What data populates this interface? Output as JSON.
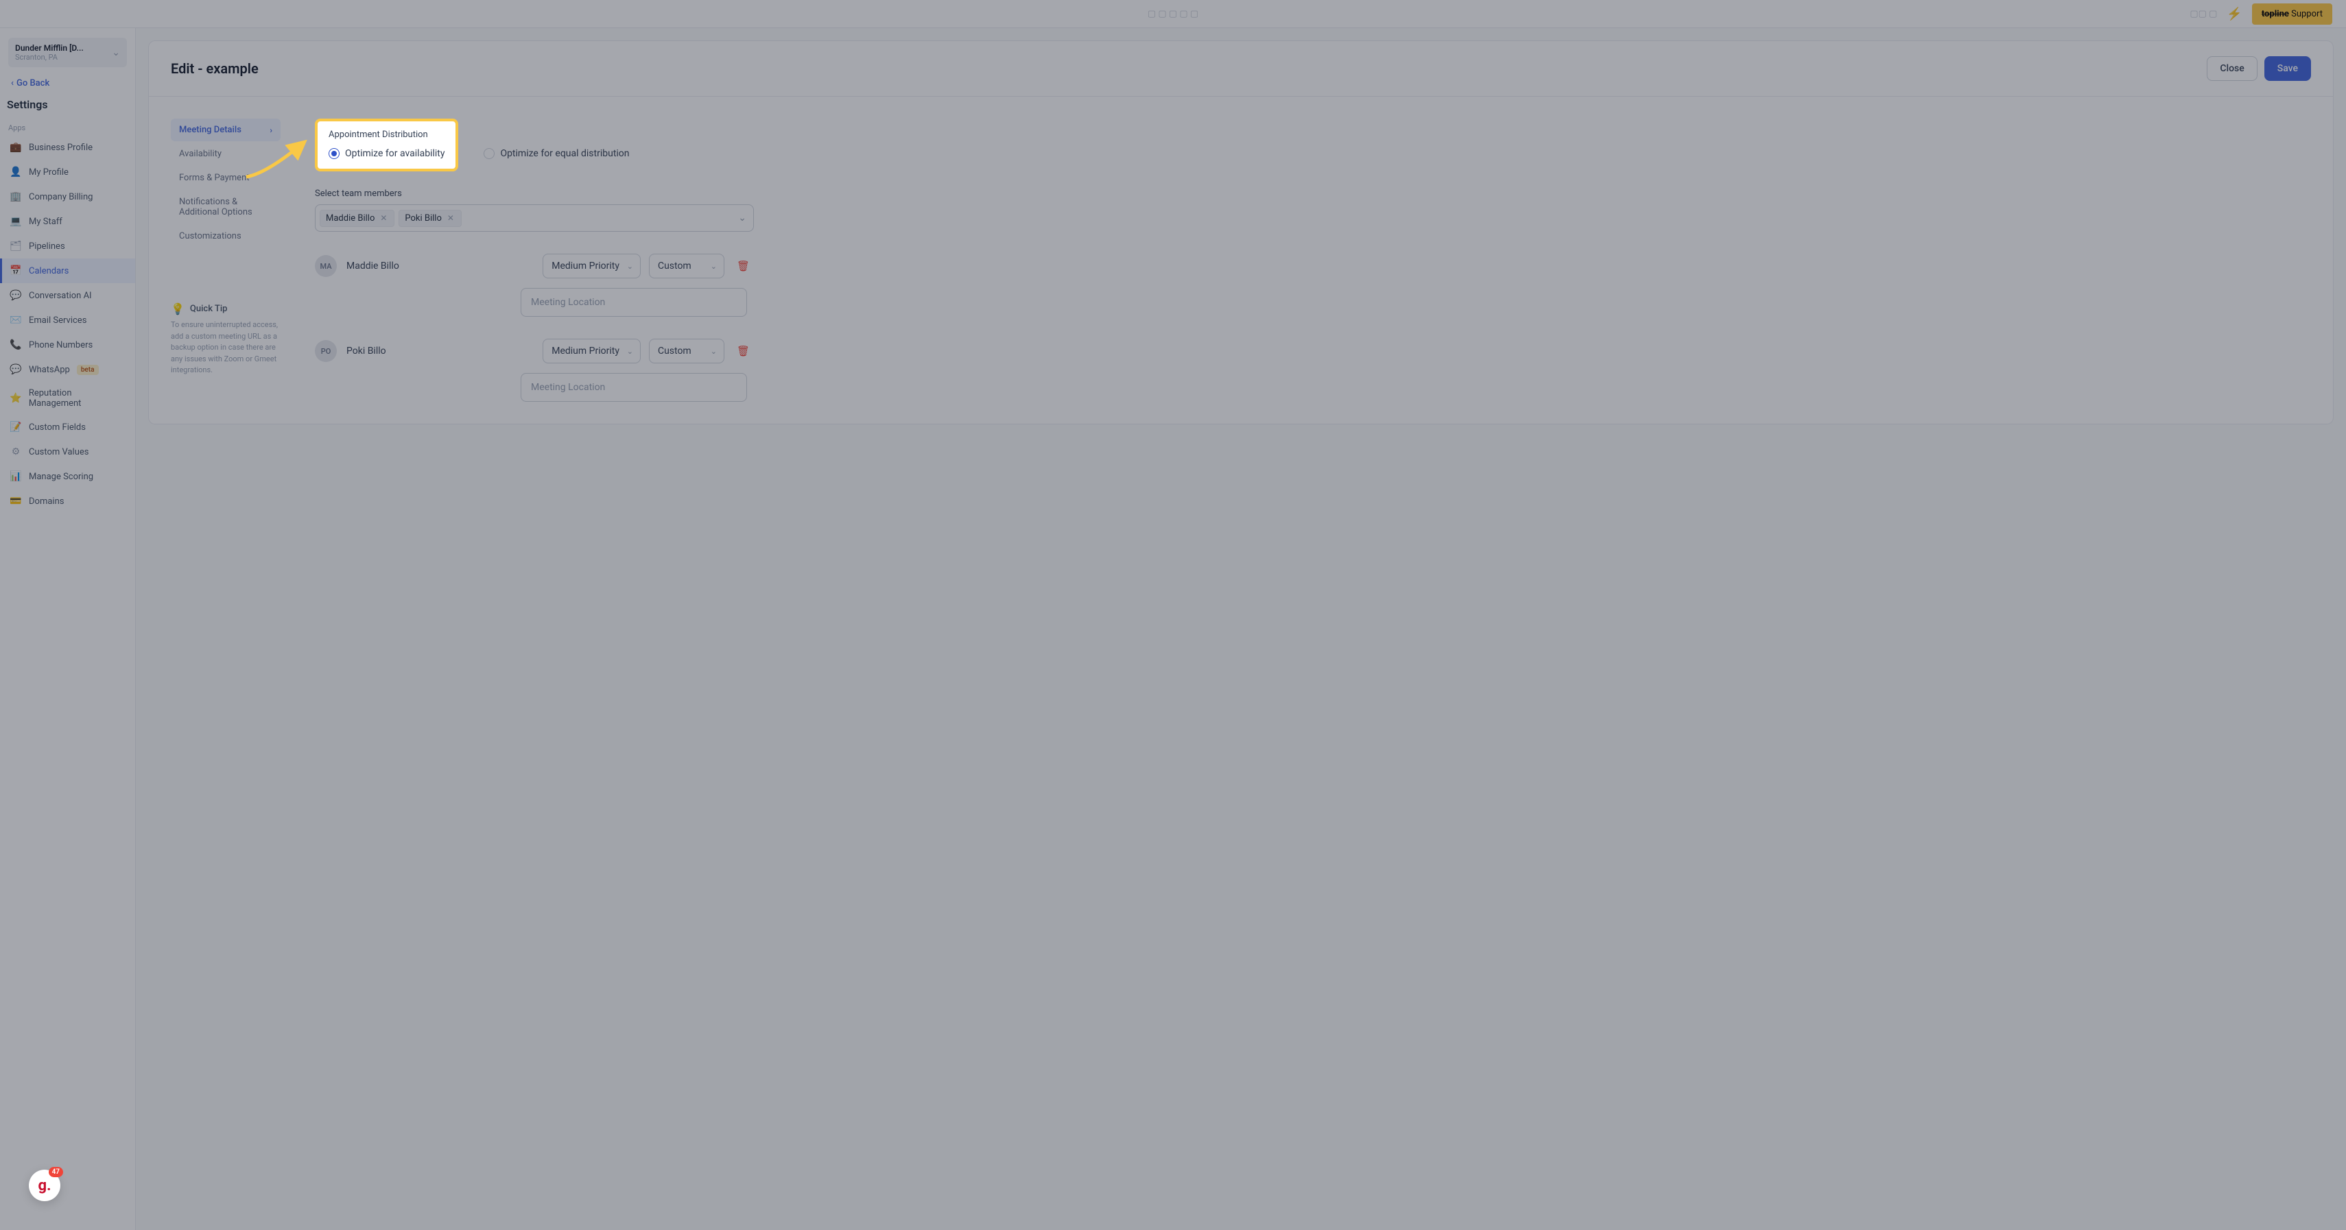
{
  "top_bar": {
    "support_prefix": "topline",
    "support_label": " Support"
  },
  "workspace": {
    "name": "Dunder Mifflin [D...",
    "location": "Scranton, PA"
  },
  "go_back": "Go Back",
  "settings_heading": "Settings",
  "section_apps": "Apps",
  "sidebar": {
    "items": [
      {
        "label": "Business Profile",
        "icon": "💼"
      },
      {
        "label": "My Profile",
        "icon": "👤"
      },
      {
        "label": "Company Billing",
        "icon": "🏢"
      },
      {
        "label": "My Staff",
        "icon": "💻"
      },
      {
        "label": "Pipelines",
        "icon": "🗂"
      },
      {
        "label": "Calendars",
        "icon": "📅"
      },
      {
        "label": "Conversation AI",
        "icon": "💬"
      },
      {
        "label": "Email Services",
        "icon": "✉️"
      },
      {
        "label": "Phone Numbers",
        "icon": "📞"
      },
      {
        "label": "WhatsApp",
        "icon": "💬",
        "badge": "beta"
      },
      {
        "label": "Reputation Management",
        "icon": "⭐"
      },
      {
        "label": "Custom Fields",
        "icon": "📝"
      },
      {
        "label": "Custom Values",
        "icon": "⚙"
      },
      {
        "label": "Manage Scoring",
        "icon": "📊"
      },
      {
        "label": "Domains",
        "icon": "💳"
      }
    ],
    "active_index": 5
  },
  "page": {
    "title": "Edit - example",
    "close": "Close",
    "save": "Save"
  },
  "panel_nav": [
    {
      "label": "Meeting Details",
      "active": true
    },
    {
      "label": "Availability"
    },
    {
      "label": "Forms & Payment"
    },
    {
      "label": "Notifications & Additional Options"
    },
    {
      "label": "Customizations"
    }
  ],
  "quick_tip": {
    "title": "Quick Tip",
    "body": "To ensure uninterrupted access, add a custom meeting URL as a backup option in case there are any issues with Zoom or Gmeet integrations."
  },
  "form": {
    "distribution_label": "Appointment Distribution",
    "opt_availability": "Optimize for availability",
    "opt_equal": "Optimize for equal distribution",
    "select_team_label": "Select team members",
    "chips": [
      "Maddie Billo",
      "Poki Billo"
    ],
    "members": [
      {
        "initials": "MA",
        "name": "Maddie Billo",
        "priority": "Medium Priority",
        "config": "Custom",
        "location_ph": "Meeting Location"
      },
      {
        "initials": "PO",
        "name": "Poki Billo",
        "priority": "Medium Priority",
        "config": "Custom",
        "location_ph": "Meeting Location"
      }
    ]
  },
  "fab": {
    "count": "47",
    "letter": "g."
  }
}
